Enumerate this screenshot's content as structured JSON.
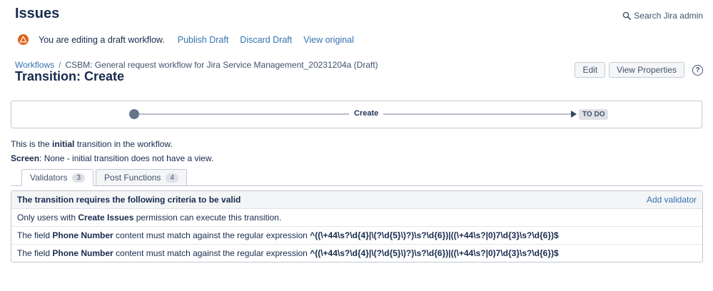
{
  "page": {
    "title": "Issues"
  },
  "topbar": {
    "search_label": "Search Jira admin"
  },
  "draft_banner": {
    "message": "You are editing a draft workflow.",
    "publish": "Publish Draft",
    "discard": "Discard Draft",
    "view_original": "View original"
  },
  "breadcrumb": {
    "root": "Workflows",
    "separator": "/",
    "current": "CSBM: General request workflow for Jira Service Management_20231204a (Draft)"
  },
  "page_header": {
    "title": "Transition: Create",
    "edit": "Edit",
    "view_properties": "View Properties",
    "help_glyph": "?"
  },
  "diagram": {
    "transition_label": "Create",
    "target_status": "TO DO"
  },
  "notes": {
    "initial_prefix": "This is the ",
    "initial_bold": "initial",
    "initial_suffix": " transition in the workflow.",
    "screen_bold": "Screen",
    "screen_text": ": None - initial transition does not have a view."
  },
  "tabs": {
    "validators": {
      "label": "Validators",
      "count": "3"
    },
    "post_functions": {
      "label": "Post Functions",
      "count": "4"
    }
  },
  "validators": {
    "header": "The transition requires the following criteria to be valid",
    "add_label": "Add validator",
    "rows": [
      {
        "prefix": "Only users with ",
        "bold": "Create Issues",
        "suffix": " permission can execute this transition.",
        "regex": ""
      },
      {
        "prefix": "The field ",
        "bold": "Phone Number",
        "suffix": " content must match against the regular expression ",
        "regex": "^((\\+44\\s?\\d{4}|\\(?\\d{5}\\)?)\\s?\\d{6})|((\\+44\\s?|0)7\\d{3}\\s?\\d{6})$"
      },
      {
        "prefix": "The field ",
        "bold": "Phone Number",
        "suffix": " content must match against the regular expression ",
        "regex": "^((\\+44\\s?\\d{4}|\\(?\\d{5}\\)?)\\s?\\d{6})|((\\+44\\s?|0)7\\d{3}\\s?\\d{6})$"
      }
    ]
  },
  "colors": {
    "text_dark": "#172b4d",
    "link_blue": "#3572b0",
    "warning_orange": "#e0631d",
    "node_grey": "#67758c",
    "lozenge_bg": "#dfe1e6",
    "table_header_bg": "#f4f5f7",
    "border": "#c1c7d0"
  }
}
